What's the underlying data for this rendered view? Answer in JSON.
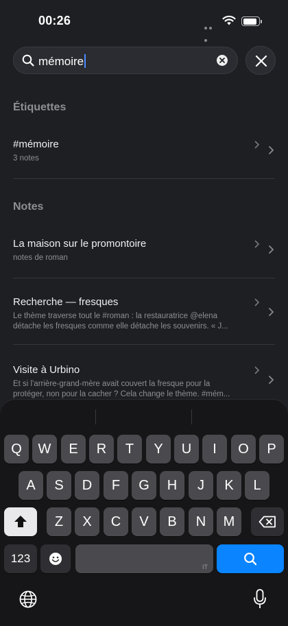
{
  "status": {
    "time": "00:26"
  },
  "search": {
    "query": "mémoire"
  },
  "sections": {
    "tags_title": "Étiquettes",
    "notes_title": "Notes"
  },
  "tags": [
    {
      "title": "#mémoire",
      "subtitle": "3 notes"
    }
  ],
  "notes": [
    {
      "title": "La maison sur le promontoire",
      "subtitle": "notes de roman"
    },
    {
      "title": "Recherche — fresques",
      "subtitle": "Le thème traverse tout le #roman : la restauratrice @elena détache les fresques comme elle détache les souvenirs. « J..."
    },
    {
      "title": "Visite à Urbino",
      "subtitle": "Et si l'arrière-grand-mère avait couvert la fresque pour la protéger, non pour la cacher ? Cela change le thème. #mém..."
    }
  ],
  "keyboard": {
    "row1": [
      "Q",
      "W",
      "E",
      "R",
      "T",
      "Y",
      "U",
      "I",
      "O",
      "P"
    ],
    "row2": [
      "A",
      "S",
      "D",
      "F",
      "G",
      "H",
      "J",
      "K",
      "L"
    ],
    "row3": [
      "Z",
      "X",
      "C",
      "V",
      "B",
      "N",
      "M"
    ],
    "numbers_label": "123",
    "space_lang": "IT"
  },
  "icons": {
    "search": "magnifier-icon",
    "clear": "clear-circle-icon",
    "close": "close-icon",
    "shift": "shift-arrow-icon",
    "delete": "backspace-icon",
    "emoji": "emoji-icon",
    "globe": "globe-icon",
    "mic": "microphone-icon"
  },
  "colors": {
    "accent": "#0a84ff",
    "caret": "#4d8cff",
    "background": "#1e1f23"
  }
}
